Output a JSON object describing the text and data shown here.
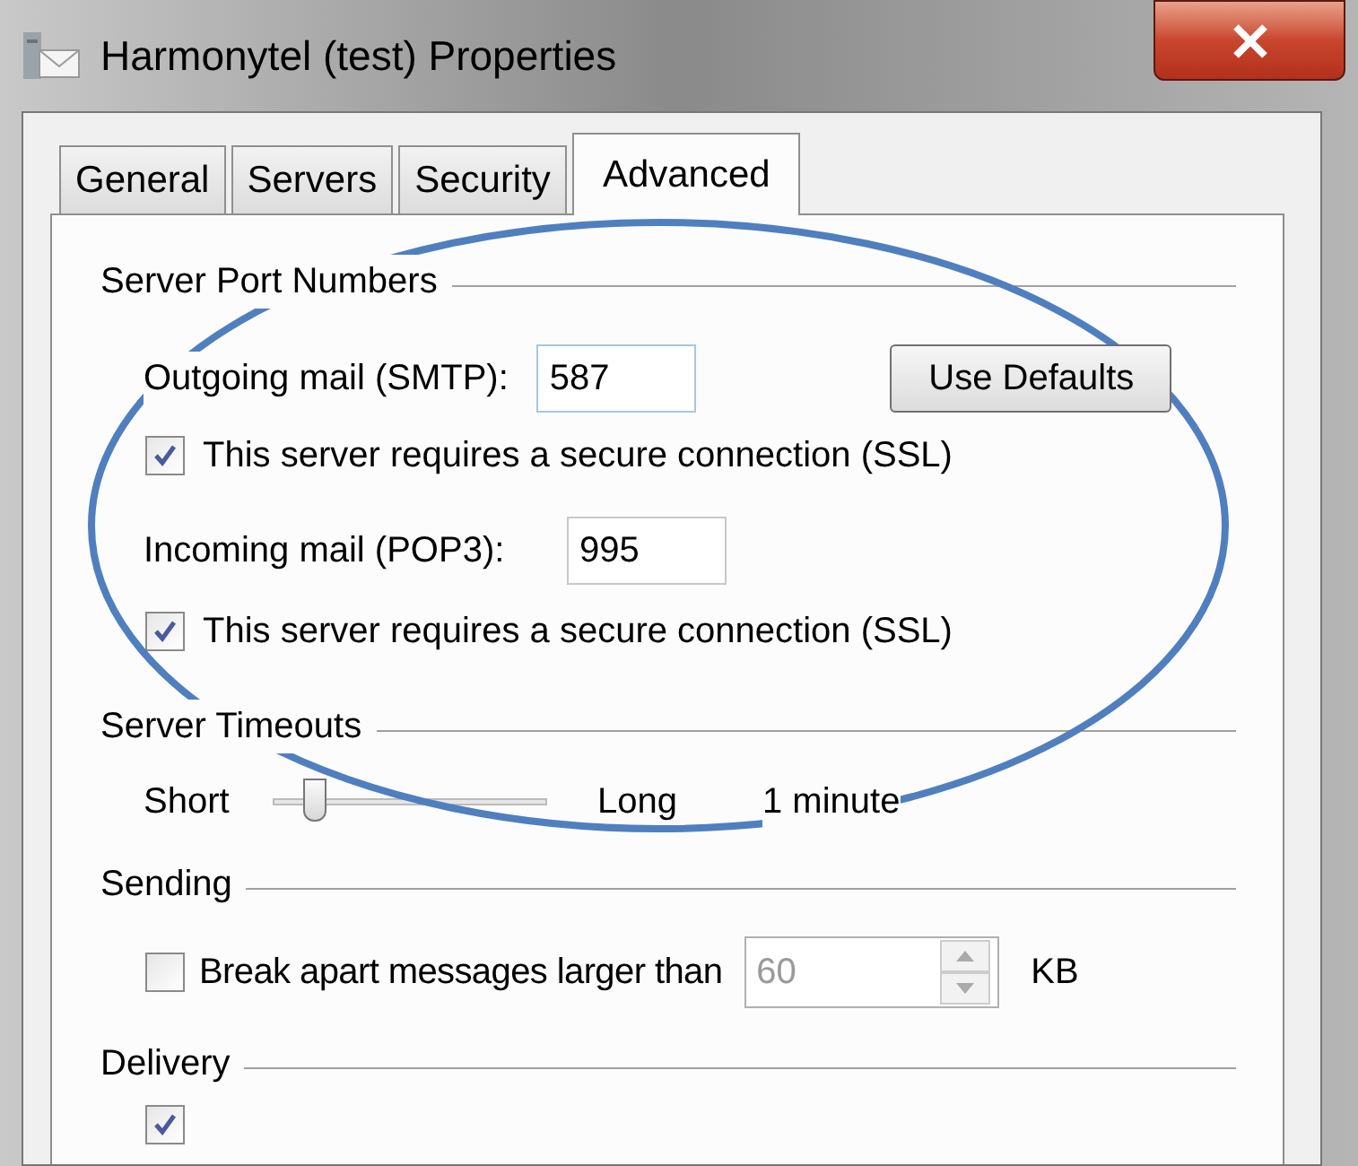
{
  "window": {
    "title": "Harmonytel (test) Properties"
  },
  "tabs": [
    {
      "label": "General",
      "selected": false
    },
    {
      "label": "Servers",
      "selected": false
    },
    {
      "label": "Security",
      "selected": false
    },
    {
      "label": "Advanced",
      "selected": true
    }
  ],
  "server_port_numbers": {
    "title": "Server Port Numbers",
    "outgoing": {
      "label": "Outgoing mail (SMTP):",
      "value": "587",
      "ssl": {
        "label": "This server requires a secure connection (SSL)",
        "checked": true
      }
    },
    "incoming": {
      "label": "Incoming mail (POP3):",
      "value": "995",
      "ssl": {
        "label": "This server requires a secure connection (SSL)",
        "checked": true
      }
    },
    "defaults_button": "Use Defaults"
  },
  "server_timeouts": {
    "title": "Server Timeouts",
    "min_label": "Short",
    "max_label": "Long",
    "level": 0.12,
    "reading": "1 minute"
  },
  "sending": {
    "title": "Sending",
    "break_apart": {
      "label": "Break apart messages larger than",
      "checked": false,
      "value": "60",
      "disabled": true,
      "unit": "KB"
    }
  },
  "delivery": {
    "title": "Delivery",
    "leave_copy": {
      "checked": true
    }
  }
}
